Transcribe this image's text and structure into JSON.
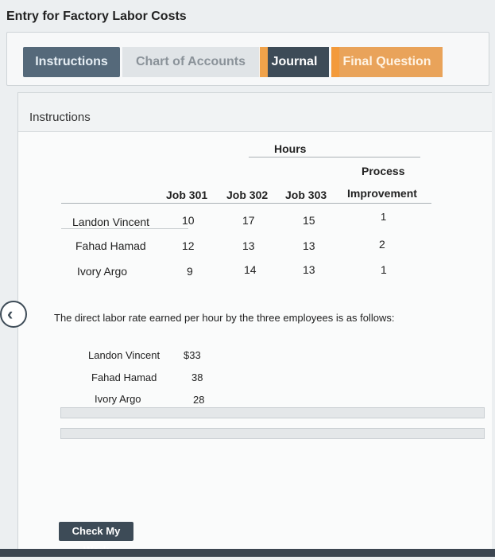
{
  "page_title": "Entry for Factory Labor Costs",
  "tabs": [
    {
      "label": "Instructions"
    },
    {
      "label": "Chart of Accounts"
    },
    {
      "label": "Journal"
    },
    {
      "label": "Final Question"
    }
  ],
  "section_title": "Instructions",
  "hours_table": {
    "group_header": "Hours",
    "columns": [
      "Job 301",
      "Job 302",
      "Job 303",
      "Process",
      "Improvement"
    ],
    "rows": [
      {
        "name": "Landon Vincent",
        "values": [
          "10",
          "17",
          "15",
          "1"
        ]
      },
      {
        "name": "Fahad Hamad",
        "values": [
          "12",
          "13",
          "13",
          "2"
        ]
      },
      {
        "name": "Ivory Argo",
        "values": [
          "9",
          "14",
          "13",
          "1"
        ]
      }
    ]
  },
  "description": "The direct labor rate earned per hour by the three employees is as follows:",
  "rates": [
    {
      "name": "Landon Vincent",
      "rate": "$33"
    },
    {
      "name": "Fahad Hamad",
      "rate": "38"
    },
    {
      "name": "Ivory Argo",
      "rate": "28"
    }
  ],
  "check_button": "Check My Work",
  "colors": {
    "accent": "#3d4b57",
    "tab_orange": "#e9a35a"
  }
}
